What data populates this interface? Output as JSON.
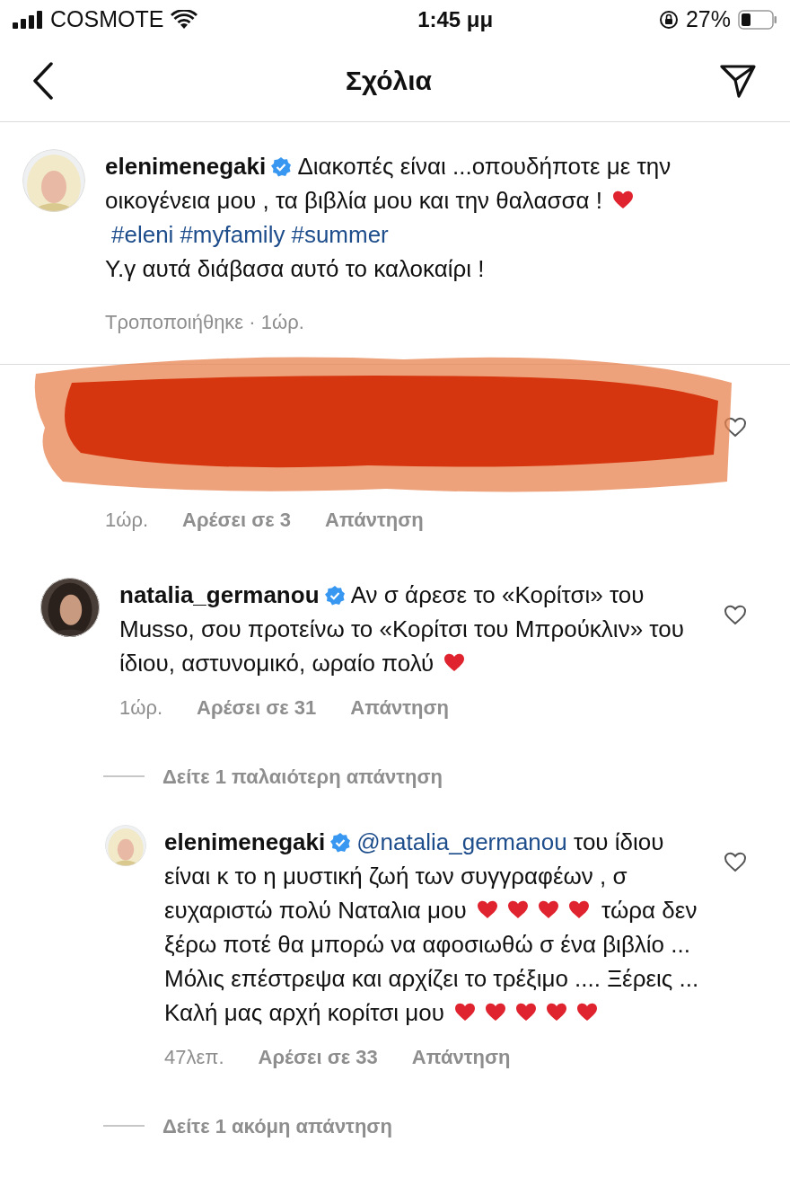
{
  "status_bar": {
    "carrier": "COSMOTE",
    "time": "1:45 μμ",
    "battery": "27%"
  },
  "header": {
    "title": "Σχόλια"
  },
  "caption": {
    "paragraphs": [
      [
        {
          "kind": "username",
          "text": "elenimenegaki"
        },
        {
          "kind": "verified"
        },
        {
          "kind": "text",
          "text": " Διακοπές  είναι ...οπουδήποτε με την οικογένεια μου , τα βιβλία μου και την θαλασσα ! "
        },
        {
          "kind": "heart"
        },
        {
          "kind": "tag",
          "text": "#eleni"
        },
        {
          "kind": "tag",
          "text": "#myfamily"
        },
        {
          "kind": "tag",
          "text": "#summer"
        }
      ],
      [
        {
          "kind": "text",
          "text": "Υ.γ αυτά διάβασα αυτό το καλοκαίρι !"
        }
      ]
    ],
    "meta": "Τροποποιήθηκε · 1ώρ."
  },
  "comments": [
    {
      "redacted": true,
      "reply": false,
      "time": "1ώρ.",
      "likes": "Αρέσει σε 3",
      "reply_label": "Απάντηση"
    },
    {
      "redacted": false,
      "reply": false,
      "paragraphs": [
        [
          {
            "kind": "username",
            "text": "natalia_germanou"
          },
          {
            "kind": "verified"
          },
          {
            "kind": "text",
            "text": " Αν σ άρεσε το «Κορίτσι» του Musso, σου προτείνω το «Κορίτσι του Μπρούκλιν» του ίδιου, αστυνομικό, ωραίο πολύ "
          },
          {
            "kind": "heart"
          }
        ]
      ],
      "time": "1ώρ.",
      "likes": "Αρέσει σε 31",
      "reply_label": "Απάντηση"
    },
    {
      "kind": "more",
      "text": "Δείτε 1 παλαιότερη απάντηση"
    },
    {
      "redacted": false,
      "reply": true,
      "paragraphs": [
        [
          {
            "kind": "username",
            "text": "elenimenegaki"
          },
          {
            "kind": "verified"
          },
          {
            "kind": "mention",
            "text": "@natalia_germanou"
          },
          {
            "kind": "text",
            "text": " του ίδιου είναι κ το η μυστική ζωή των συγγραφέων , σ ευχαριστώ πολύ Ναταλια μου "
          },
          {
            "kind": "heart"
          },
          {
            "kind": "heart"
          },
          {
            "kind": "heart"
          },
          {
            "kind": "heart"
          },
          {
            "kind": "text",
            "text": " τώρα δεν ξέρω ποτέ θα μπορώ να αφοσιωθώ σ ένα βιβλίο ... Μόλις επέστρεψα και αρχίζει το τρέξιμο .... Ξέρεις ... Καλή μας αρχή κορίτσι μου "
          },
          {
            "kind": "heart"
          },
          {
            "kind": "heart"
          },
          {
            "kind": "heart"
          },
          {
            "kind": "heart"
          },
          {
            "kind": "heart"
          }
        ]
      ],
      "time": "47λεπ.",
      "likes": "Αρέσει σε 33",
      "reply_label": "Απάντηση"
    },
    {
      "kind": "more",
      "text": "Δείτε 1 ακόμη απάντηση"
    }
  ]
}
